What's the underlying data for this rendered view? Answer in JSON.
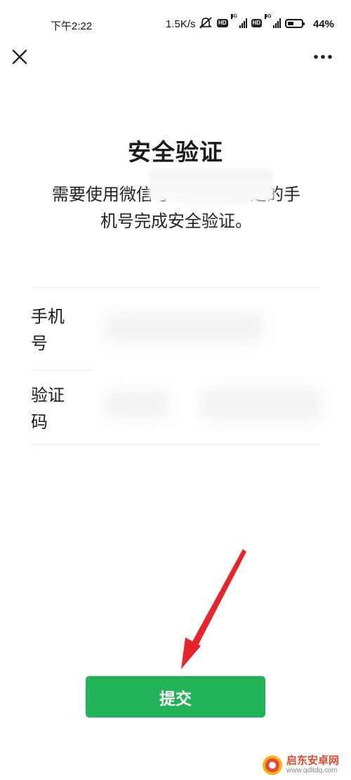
{
  "status_bar": {
    "time": "下午2:22",
    "net_speed": "1.5K/s",
    "hd_label": "HD",
    "network_type": "4G",
    "battery_percent": "44%",
    "battery_level": 0.44
  },
  "nav": {
    "close_icon": "close-icon",
    "more_icon": "more-horizontal-icon"
  },
  "page": {
    "title": "安全验证",
    "description_prefix": "需要使用微信号",
    "description_middle": "绑定的手",
    "description_suffix": "机号完成安全验证。"
  },
  "form": {
    "phone_label_line1": "手机",
    "phone_label_line2": "号",
    "code_label_line1": "验证",
    "code_label_line2": "码"
  },
  "submit": {
    "label": "提交",
    "color": "#22b359"
  },
  "watermark": {
    "name": "启东安卓网",
    "url": "www.qdltdq.com"
  },
  "colors": {
    "accent": "#22b359",
    "annotation_arrow": "#e8242b"
  }
}
